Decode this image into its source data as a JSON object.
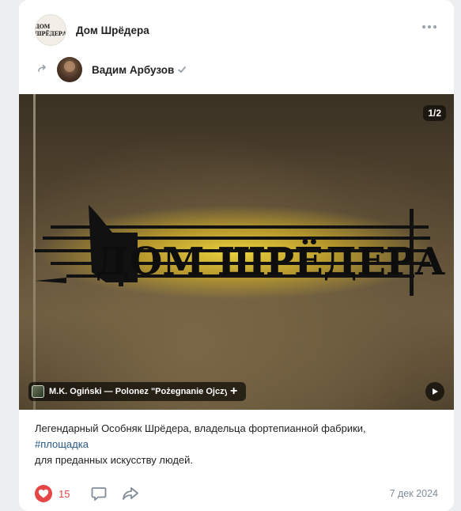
{
  "post": {
    "group_name": "Дом Шрёдера",
    "group_logo_text": "ДОМ ШРЁДЕРА",
    "author_name": "Вадим Арбузов",
    "photo": {
      "page_counter": "1/2",
      "sign_text": "ДОМ ШРЁДЕРА"
    },
    "audio": {
      "title": "M.K. Ogiński — Polonez \"Pożegnanie Ojczyzny\""
    },
    "text": {
      "line1": "Легендарный Особняк Шрёдера, владельца фортепианной фабрики,",
      "hashtag": "#площадка",
      "line3": "для преданных искусству людей."
    },
    "likes": "15",
    "date": "7 дек 2024"
  },
  "icons": {
    "more": "more-horizontal-icon",
    "repost": "repost-arrow-icon",
    "verified": "check-icon",
    "play": "play-icon",
    "add": "plus-icon",
    "like": "heart-icon",
    "comment": "comment-icon",
    "share": "share-icon"
  },
  "colors": {
    "accent_like": "#e64646",
    "link": "#2a5885",
    "muted": "#818c99",
    "background": "#edeef0"
  }
}
